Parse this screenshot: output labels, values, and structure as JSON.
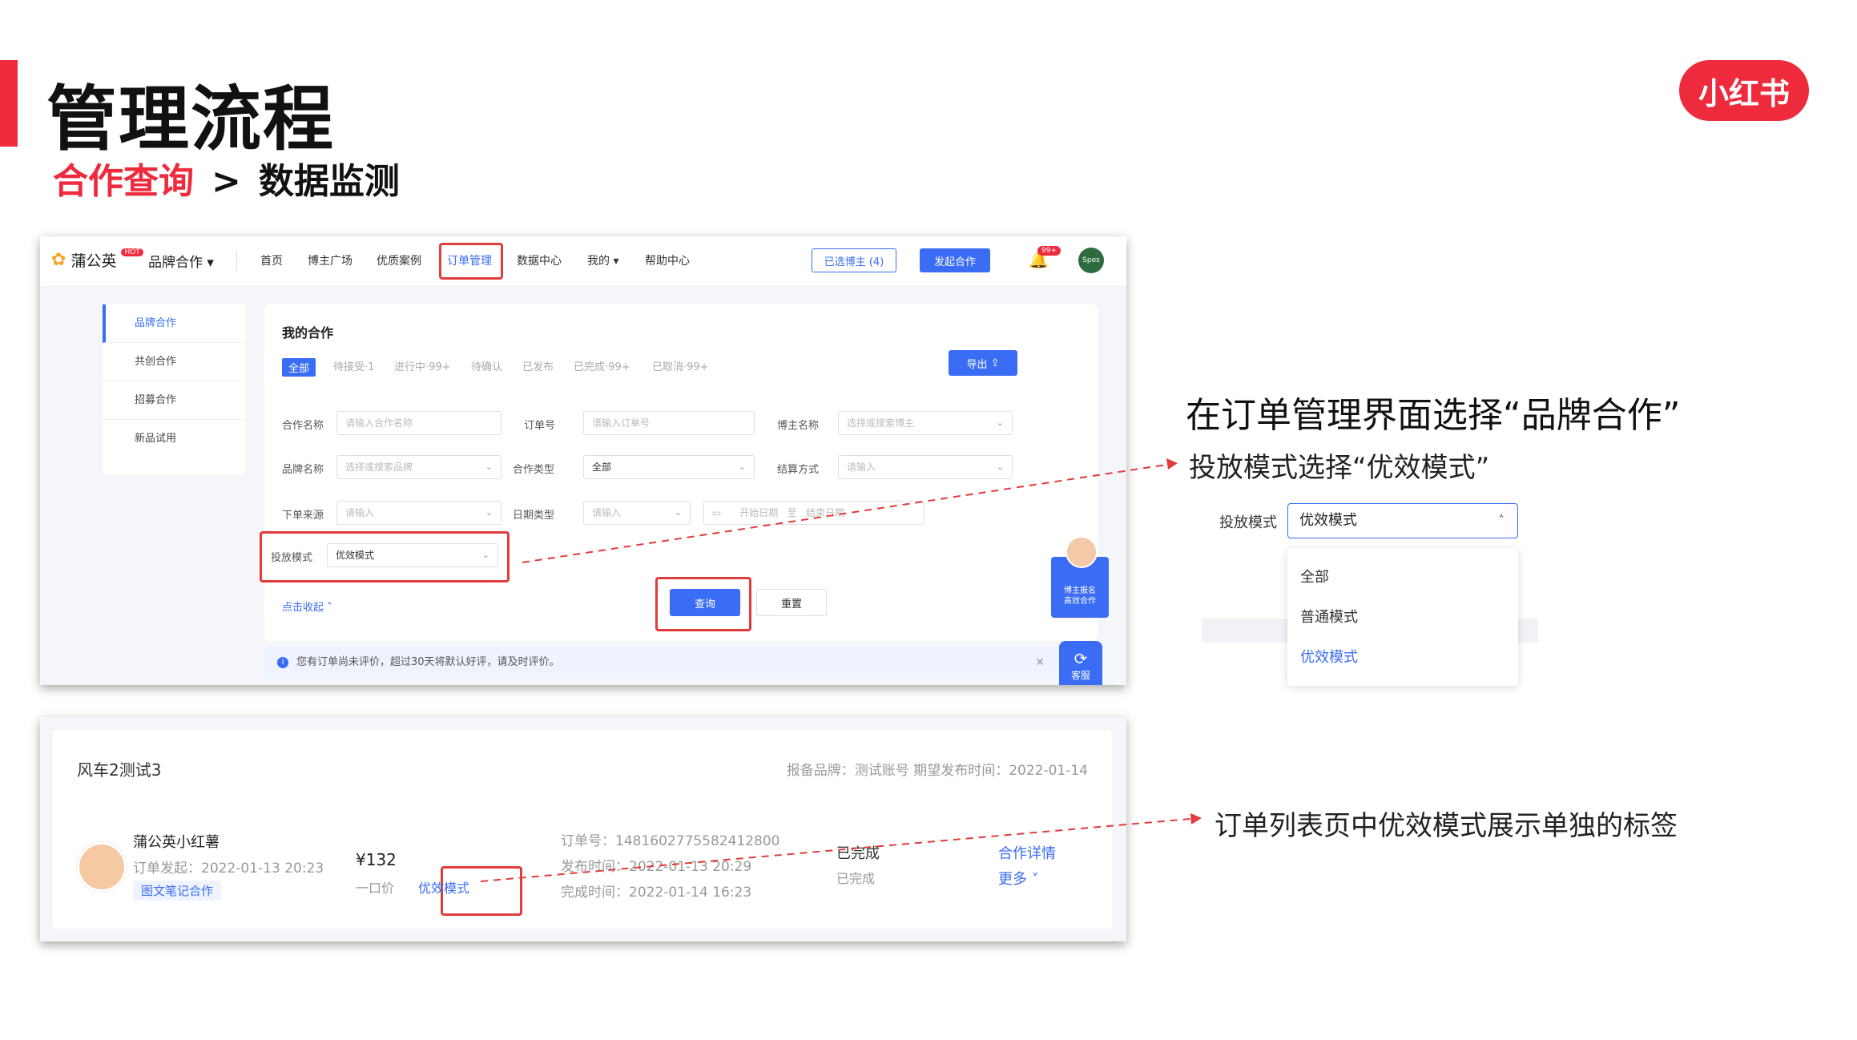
{
  "slide": {
    "title": "管理流程",
    "breadcrumb_current": "合作查询",
    "breadcrumb_sep": ">",
    "breadcrumb_next": "数据监测",
    "logo": "小红书"
  },
  "nav": {
    "brand": "蒲公英",
    "brand_badge": "HOT",
    "brand_menu": "品牌合作 ▾",
    "items": [
      "首页",
      "博主广场",
      "优质案例",
      "订单管理",
      "数据中心",
      "我的 ▾",
      "帮助中心"
    ],
    "selected_btn": "已选博主 (4)",
    "create_btn": "发起合作",
    "bell_badge": "99+",
    "avatar_text": "Spes"
  },
  "sidebar": {
    "items": [
      "品牌合作",
      "共创合作",
      "招募合作",
      "新品试用"
    ]
  },
  "panel": {
    "title": "我的合作",
    "tabs": [
      "全部",
      "待接受·1",
      "进行中·99+",
      "待确认",
      "已发布",
      "已完成·99+",
      "已取消·99+"
    ],
    "export_btn": "导出",
    "fields": {
      "coop_name_label": "合作名称",
      "coop_name_ph": "请输入合作名称",
      "order_no_label": "订单号",
      "order_no_ph": "请输入订单号",
      "blogger_label": "博主名称",
      "blogger_ph": "选择或搜索博主",
      "brand_label": "品牌名称",
      "brand_ph": "选择或搜索品牌",
      "coop_type_label": "合作类型",
      "coop_type_val": "全部",
      "settle_label": "结算方式",
      "settle_ph": "请输入",
      "source_label": "下单来源",
      "source_ph": "请输入",
      "date_type_label": "日期类型",
      "date_type_ph": "请输入",
      "date_start_ph": "开始日期",
      "date_to": "至",
      "date_end_ph": "结束日期",
      "mode_label": "投放模式",
      "mode_val": "优效模式"
    },
    "collapse_link": "点击收起 ˄",
    "query_btn": "查询",
    "reset_btn": "重置",
    "notice": "您有订单尚未评价，超过30天将默认好评，请及时评价。",
    "promo": "博主报名\n高效合作",
    "service": "客服"
  },
  "order": {
    "title": "风车2测试3",
    "meta": "报备品牌：测试账号   期望发布时间：2022-01-14",
    "blogger": "蒲公英小红薯",
    "created": "订单发起：2022-01-13 20:23",
    "tag": "图文笔记合作",
    "price": "¥132",
    "price_type": "一口价",
    "mode": "优效模式",
    "order_no": "订单号：1481602775582412800",
    "publish_time": "发布时间：2022-01-13 20:29",
    "finish_time": "完成时间：2022-01-14 16:23",
    "status": "已完成",
    "status_sub": "已完成",
    "link_detail": "合作详情",
    "link_more": "更多 ˅"
  },
  "annotations": {
    "title": "在订单管理界面选择“品牌合作”",
    "sub": "投放模式选择“优效模式”",
    "dropdown_label": "投放模式",
    "dropdown_value": "优效模式",
    "dropdown_options": [
      "全部",
      "普通模式",
      "优效模式"
    ],
    "bottom": "订单列表页中优效模式展示单独的标签"
  },
  "colors": {
    "accent": "#3a6cf4",
    "brand_red": "#ee2a3d",
    "highlight": "#e23b3b"
  }
}
